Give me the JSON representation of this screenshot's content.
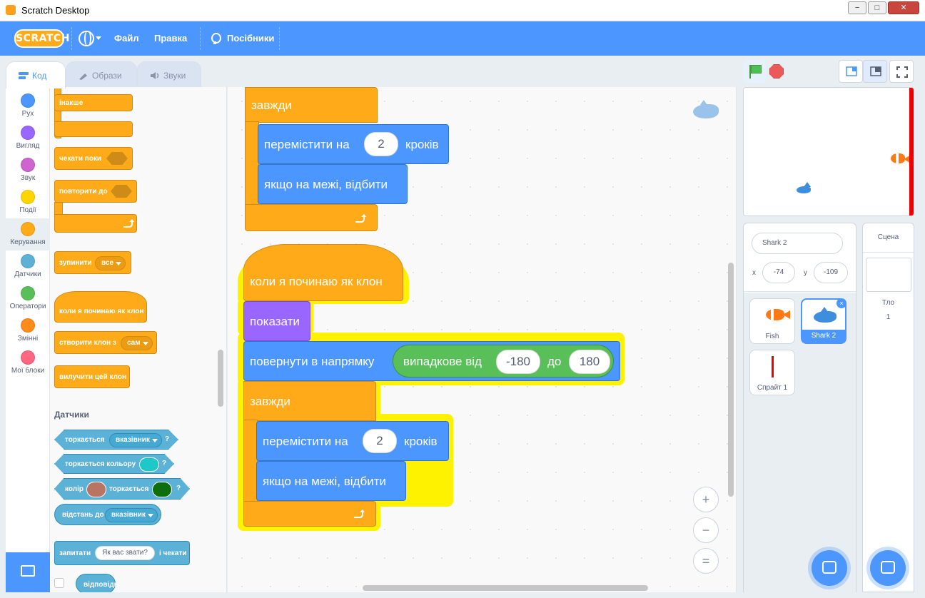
{
  "window": {
    "title": "Scratch Desktop",
    "minimize": "−",
    "maximize": "□",
    "close": "✕"
  },
  "menubar": {
    "logo": "SCRATCH",
    "file": "Файл",
    "edit": "Правка",
    "tutorials": "Посібники"
  },
  "tabs": {
    "code": "Код",
    "costumes": "Образи",
    "sounds": "Звуки"
  },
  "categories": [
    {
      "label": "Рух",
      "color": "#4c97ff"
    },
    {
      "label": "Вигляд",
      "color": "#9966ff"
    },
    {
      "label": "Звук",
      "color": "#cf63cf"
    },
    {
      "label": "Події",
      "color": "#ffd500"
    },
    {
      "label": "Керування",
      "color": "#ffab19"
    },
    {
      "label": "Датчики",
      "color": "#5cb1d6"
    },
    {
      "label": "Оператори",
      "color": "#59c059"
    },
    {
      "label": "Змінні",
      "color": "#ff8c1a"
    },
    {
      "label": "Мої блоки",
      "color": "#ff6680"
    }
  ],
  "palette": {
    "else": "інакше",
    "wait_until": "чекати поки",
    "repeat_until": "повторити до",
    "stop": "зупинити",
    "stop_option": "все",
    "when_clone": "коли я починаю як клон",
    "create_clone": "створити клон з",
    "create_clone_option": "сам",
    "delete_clone": "вилучити цей клон",
    "sensing_title": "Датчики",
    "touching": "торкається",
    "touching_option": "вказівник",
    "touching_color": "торкається кольору",
    "color": "колір",
    "color_touching": "торкається",
    "distance_to": "відстань до",
    "distance_option": "вказівник",
    "ask": "запитати",
    "ask_default": "Як вас звати?",
    "and_wait": "і чекати",
    "answer": "відповідь",
    "question_mark": "?"
  },
  "script1": {
    "forever": "завжди",
    "move": "перемістити на",
    "move_value": "2",
    "steps": "кроків",
    "bounce": "якщо на межі, відбити"
  },
  "script2": {
    "hat": "коли я починаю як клон",
    "show": "показати",
    "point": "повернути в напрямку",
    "random": "випадкове від",
    "random_from": "-180",
    "random_to_label": "до",
    "random_to": "180",
    "forever": "завжди",
    "move": "перемістити на",
    "move_value": "2",
    "steps": "кроків",
    "bounce": "якщо на межі, відбити"
  },
  "zoom": {
    "in": "+",
    "out": "−",
    "reset": "="
  },
  "sprite_info": {
    "name": "Shark 2",
    "x_label": "x",
    "x": "-74",
    "y_label": "y",
    "y": "-109"
  },
  "sprites": [
    {
      "name": "Fish",
      "selected": false
    },
    {
      "name": "Shark 2",
      "selected": true
    },
    {
      "name": "Спрайт 1",
      "selected": false
    }
  ],
  "stage_panel": {
    "title": "Сцена",
    "backdrops_label": "Тло",
    "backdrops_count": "1"
  }
}
